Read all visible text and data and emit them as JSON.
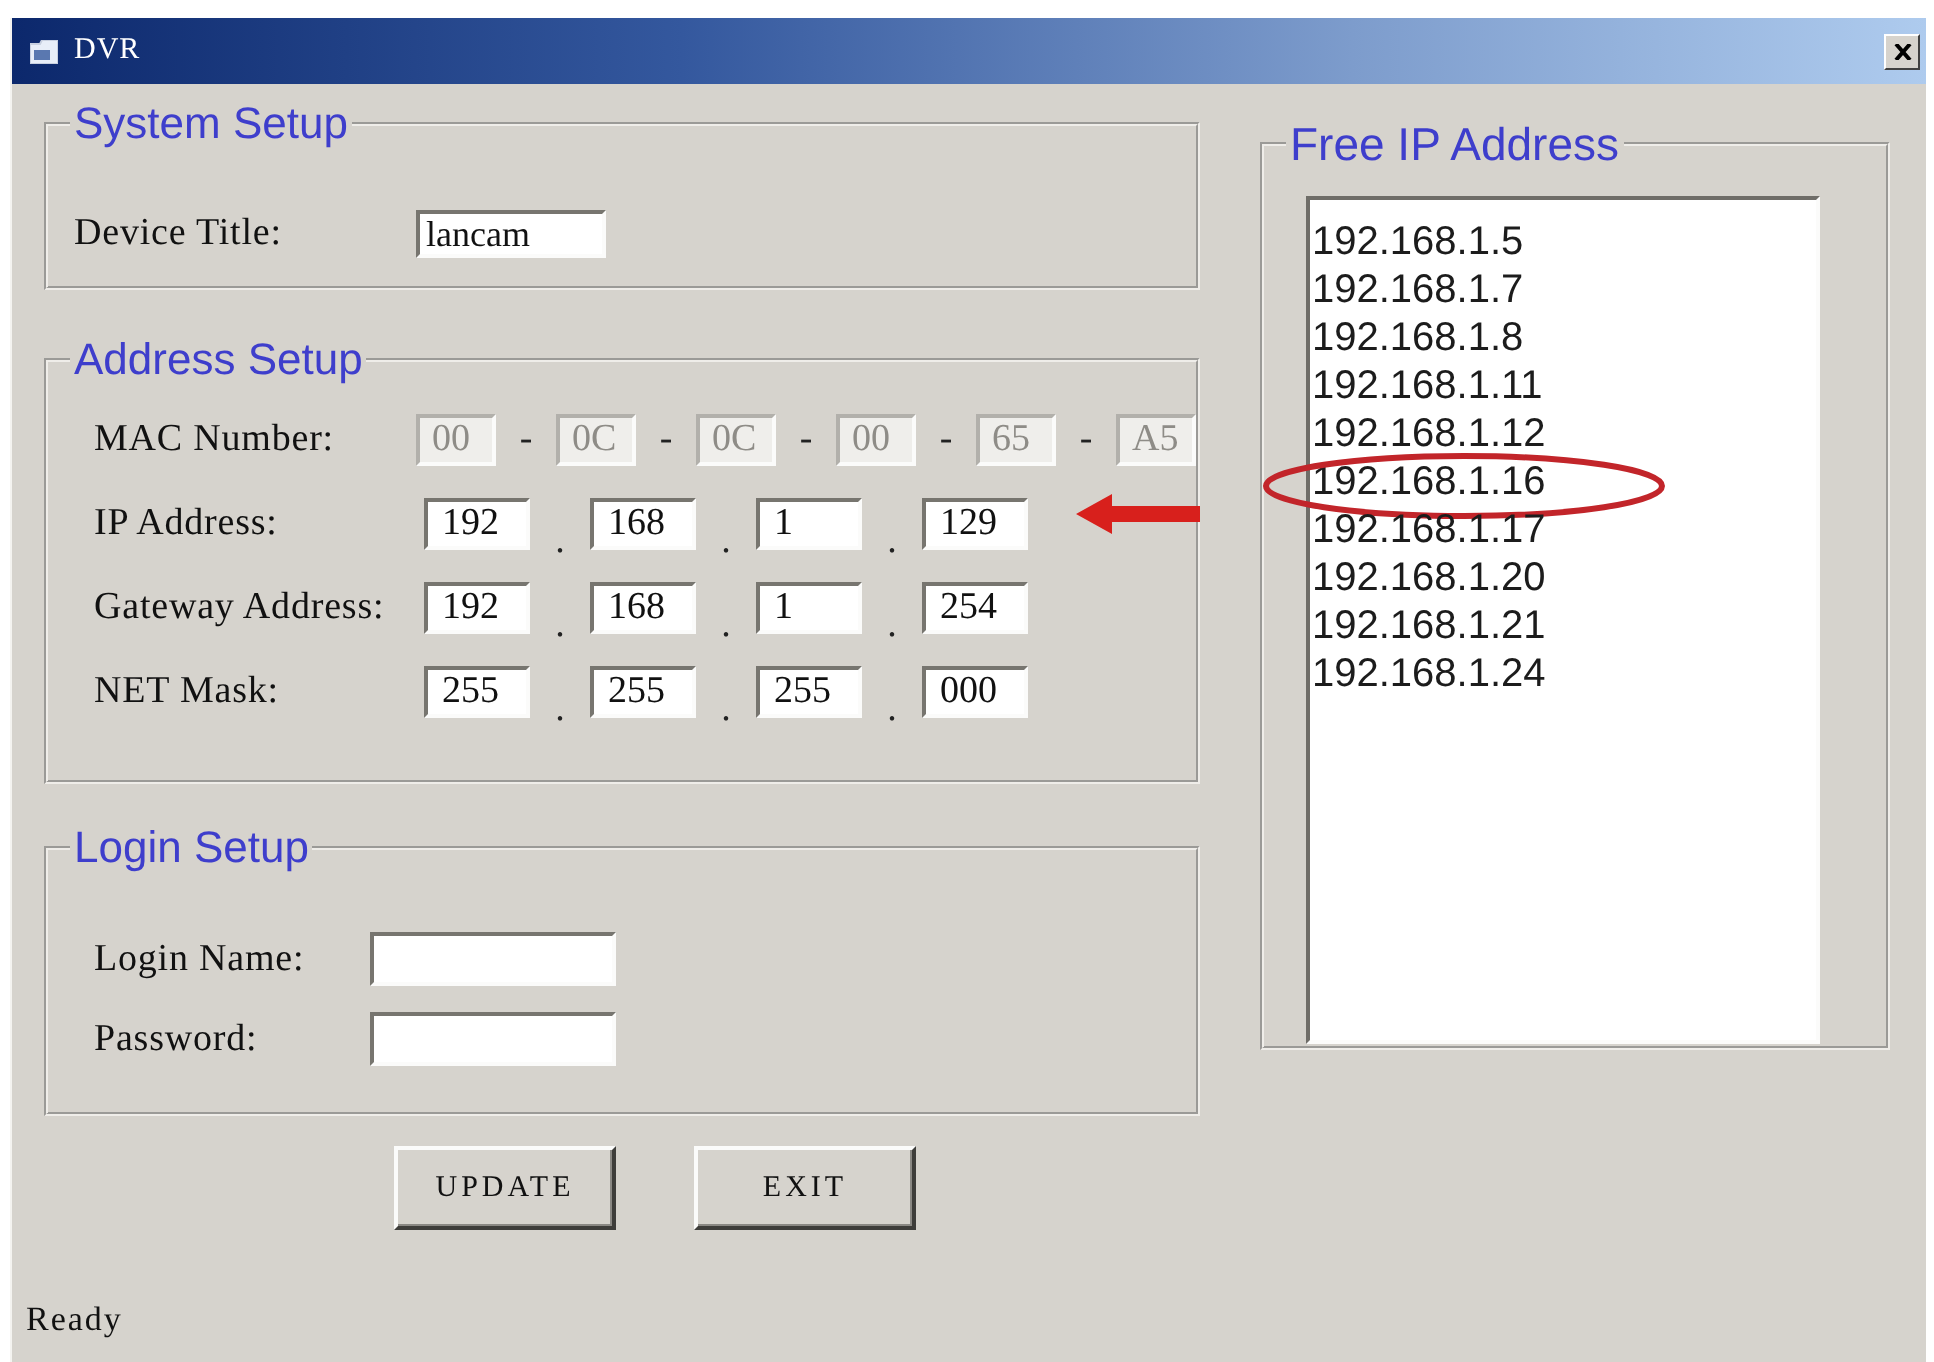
{
  "window": {
    "title": "DVR"
  },
  "system_setup": {
    "title": "System Setup",
    "fields": [
      {
        "label": "Device Title:",
        "value": "lancam"
      }
    ]
  },
  "address_setup": {
    "title": "Address Setup",
    "rows": [
      {
        "label": "MAC Number:",
        "kind": "mac",
        "disabled": true,
        "values": [
          "00",
          "0C",
          "0C",
          "00",
          "65",
          "A5"
        ],
        "separators": [
          "-",
          "-",
          "-",
          "-",
          "-"
        ]
      },
      {
        "label": "IP Address:",
        "kind": "ip",
        "disabled": false,
        "values": [
          "192",
          "168",
          "1",
          "129"
        ],
        "separators": [
          ".",
          ".",
          "."
        ]
      },
      {
        "label": "Gateway Address:",
        "kind": "ip",
        "disabled": false,
        "values": [
          "192",
          "168",
          "1",
          "254"
        ],
        "separators": [
          ".",
          ".",
          "."
        ]
      },
      {
        "label": "NET Mask:",
        "kind": "ip",
        "disabled": false,
        "values": [
          "255",
          "255",
          "255",
          "000"
        ],
        "separators": [
          ".",
          ".",
          "."
        ]
      }
    ]
  },
  "login_setup": {
    "title": "Login Setup",
    "fields": [
      {
        "label": "Login Name:"
      },
      {
        "label": "Password:"
      }
    ]
  },
  "buttons": [
    {
      "label": "UPDATE"
    },
    {
      "label": "EXIT"
    }
  ],
  "free_ip": {
    "title": "Free IP Address",
    "addresses": [
      {
        "text": "192.168.1.5",
        "selected": false,
        "circled": false
      },
      {
        "text": "192.168.1.7",
        "selected": false,
        "circled": false
      },
      {
        "text": "192.168.1.8",
        "selected": false,
        "circled": false
      },
      {
        "text": "192.168.1.11",
        "selected": false,
        "circled": false
      },
      {
        "text": "192.168.1.12",
        "selected": false,
        "circled": false
      },
      {
        "text": "192.168.1.16",
        "selected": false,
        "circled": true
      },
      {
        "text": "192.168.1.17",
        "selected": false,
        "circled": false
      },
      {
        "text": "192.168.1.20",
        "selected": false,
        "circled": false
      },
      {
        "text": "192.168.1.21",
        "selected": false,
        "circled": false
      },
      {
        "text": "192.168.1.24",
        "selected": false,
        "circled": false
      }
    ]
  },
  "status_bar": {
    "text": "Ready"
  }
}
